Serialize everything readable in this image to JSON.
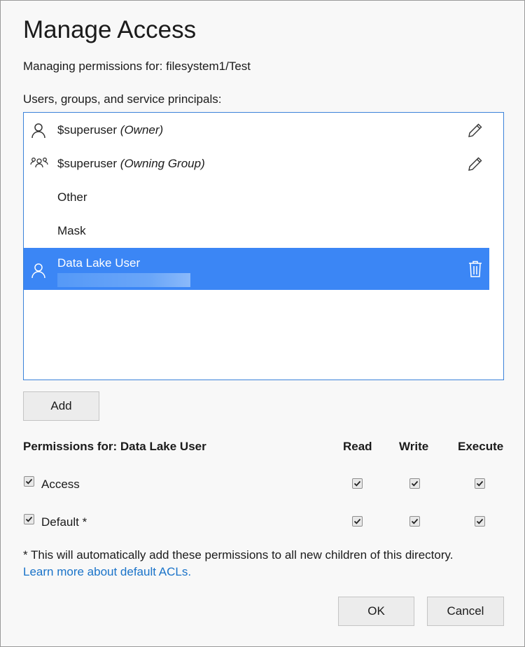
{
  "dialog": {
    "title": "Manage Access",
    "subtitle": "Managing permissions for: filesystem1/Test",
    "list_label": "Users, groups, and service principals:"
  },
  "principals": [
    {
      "name": "$superuser",
      "role": "(Owner)",
      "icon": "user-icon",
      "action": "edit-pencil-icon"
    },
    {
      "name": "$superuser",
      "role": "(Owning Group)",
      "icon": "group-icon",
      "action": "edit-pencil-icon"
    },
    {
      "name": "Other",
      "role": "",
      "icon": "",
      "action": ""
    },
    {
      "name": "Mask",
      "role": "",
      "icon": "",
      "action": ""
    },
    {
      "name": "Data Lake User",
      "role": "",
      "icon": "user-icon",
      "action": "trash-icon",
      "selected": true
    }
  ],
  "add_button": "Add",
  "permissions": {
    "header": "Permissions for: Data Lake User",
    "columns": [
      "Read",
      "Write",
      "Execute"
    ],
    "rows": [
      {
        "label": "Access",
        "enabled": true,
        "read": true,
        "write": true,
        "execute": true
      },
      {
        "label": "Default *",
        "enabled": true,
        "read": true,
        "write": true,
        "execute": true
      }
    ]
  },
  "footnote": "* This will automatically add these permissions to all new children of this directory.",
  "learn_more_link": "Learn more about default ACLs.",
  "ok_button": "OK",
  "cancel_button": "Cancel",
  "colors": {
    "accent": "#3b86f5",
    "link": "#1a73c9",
    "list_border": "#3b82d9"
  }
}
